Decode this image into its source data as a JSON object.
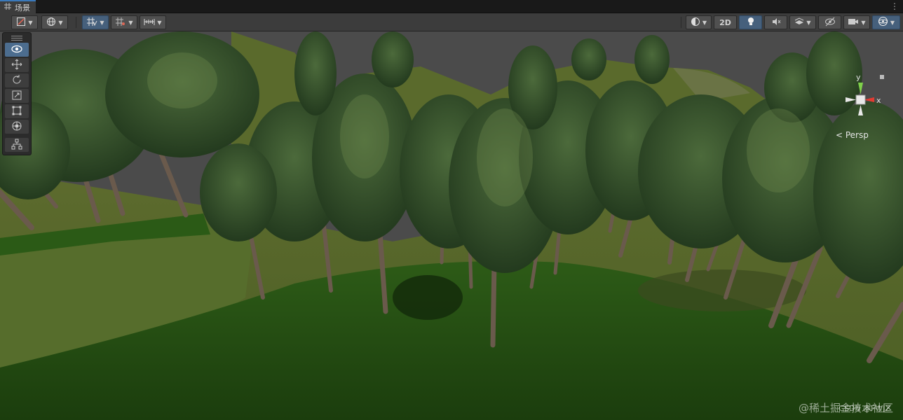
{
  "tab": {
    "title": "场景",
    "icon": "grid-icon",
    "menu_glyph": "⋮"
  },
  "toolbar": {
    "left": [
      {
        "name": "draw-mode-dropdown",
        "icon": "shaded-draw-mode-icon",
        "active": false
      },
      {
        "name": "global-local-dropdown",
        "icon": "globe-icon",
        "active": false
      },
      {
        "name": "grid-snap-dropdown",
        "icon": "grid-snap-icon",
        "active": true
      },
      {
        "name": "grid-visibility-dropdown",
        "icon": "grid-visibility-icon",
        "active": false
      },
      {
        "name": "increment-snap-dropdown",
        "icon": "ruler-icon",
        "active": false
      }
    ],
    "right": {
      "shading_icon": "shading-sphere-icon",
      "mode_2d_label": "2D",
      "lighting_icon": "lightbulb-icon",
      "audio_icon": "audio-mute-icon",
      "effects_icon": "effects-icon",
      "hidden_icon": "eye-slash-icon",
      "camera_icon": "camera-icon",
      "gizmos_icon": "gizmo-sphere-icon"
    }
  },
  "tools": [
    {
      "name": "view-tool",
      "icon": "eye-icon",
      "active": true
    },
    {
      "name": "move-tool",
      "icon": "move-icon",
      "active": false
    },
    {
      "name": "rotate-tool",
      "icon": "rotate-icon",
      "active": false
    },
    {
      "name": "scale-tool",
      "icon": "scale-icon",
      "active": false
    },
    {
      "name": "rect-tool",
      "icon": "rect-icon",
      "active": false
    },
    {
      "name": "transform-tool",
      "icon": "transform-icon",
      "active": false
    },
    {
      "name": "custom-tool",
      "icon": "custom-editor-tool-icon",
      "active": false
    }
  ],
  "gizmo": {
    "y_label": "y",
    "x_label": "x",
    "projection_label": "< Persp"
  },
  "watermark": {
    "text": "@稀土掘金技术社区",
    "subtext": "CSDN @FWJZ"
  },
  "colors": {
    "accent": "#3a79bb",
    "active_button": "#46607c",
    "grass": "#1f4a14",
    "sky": "#4b4b4b"
  }
}
